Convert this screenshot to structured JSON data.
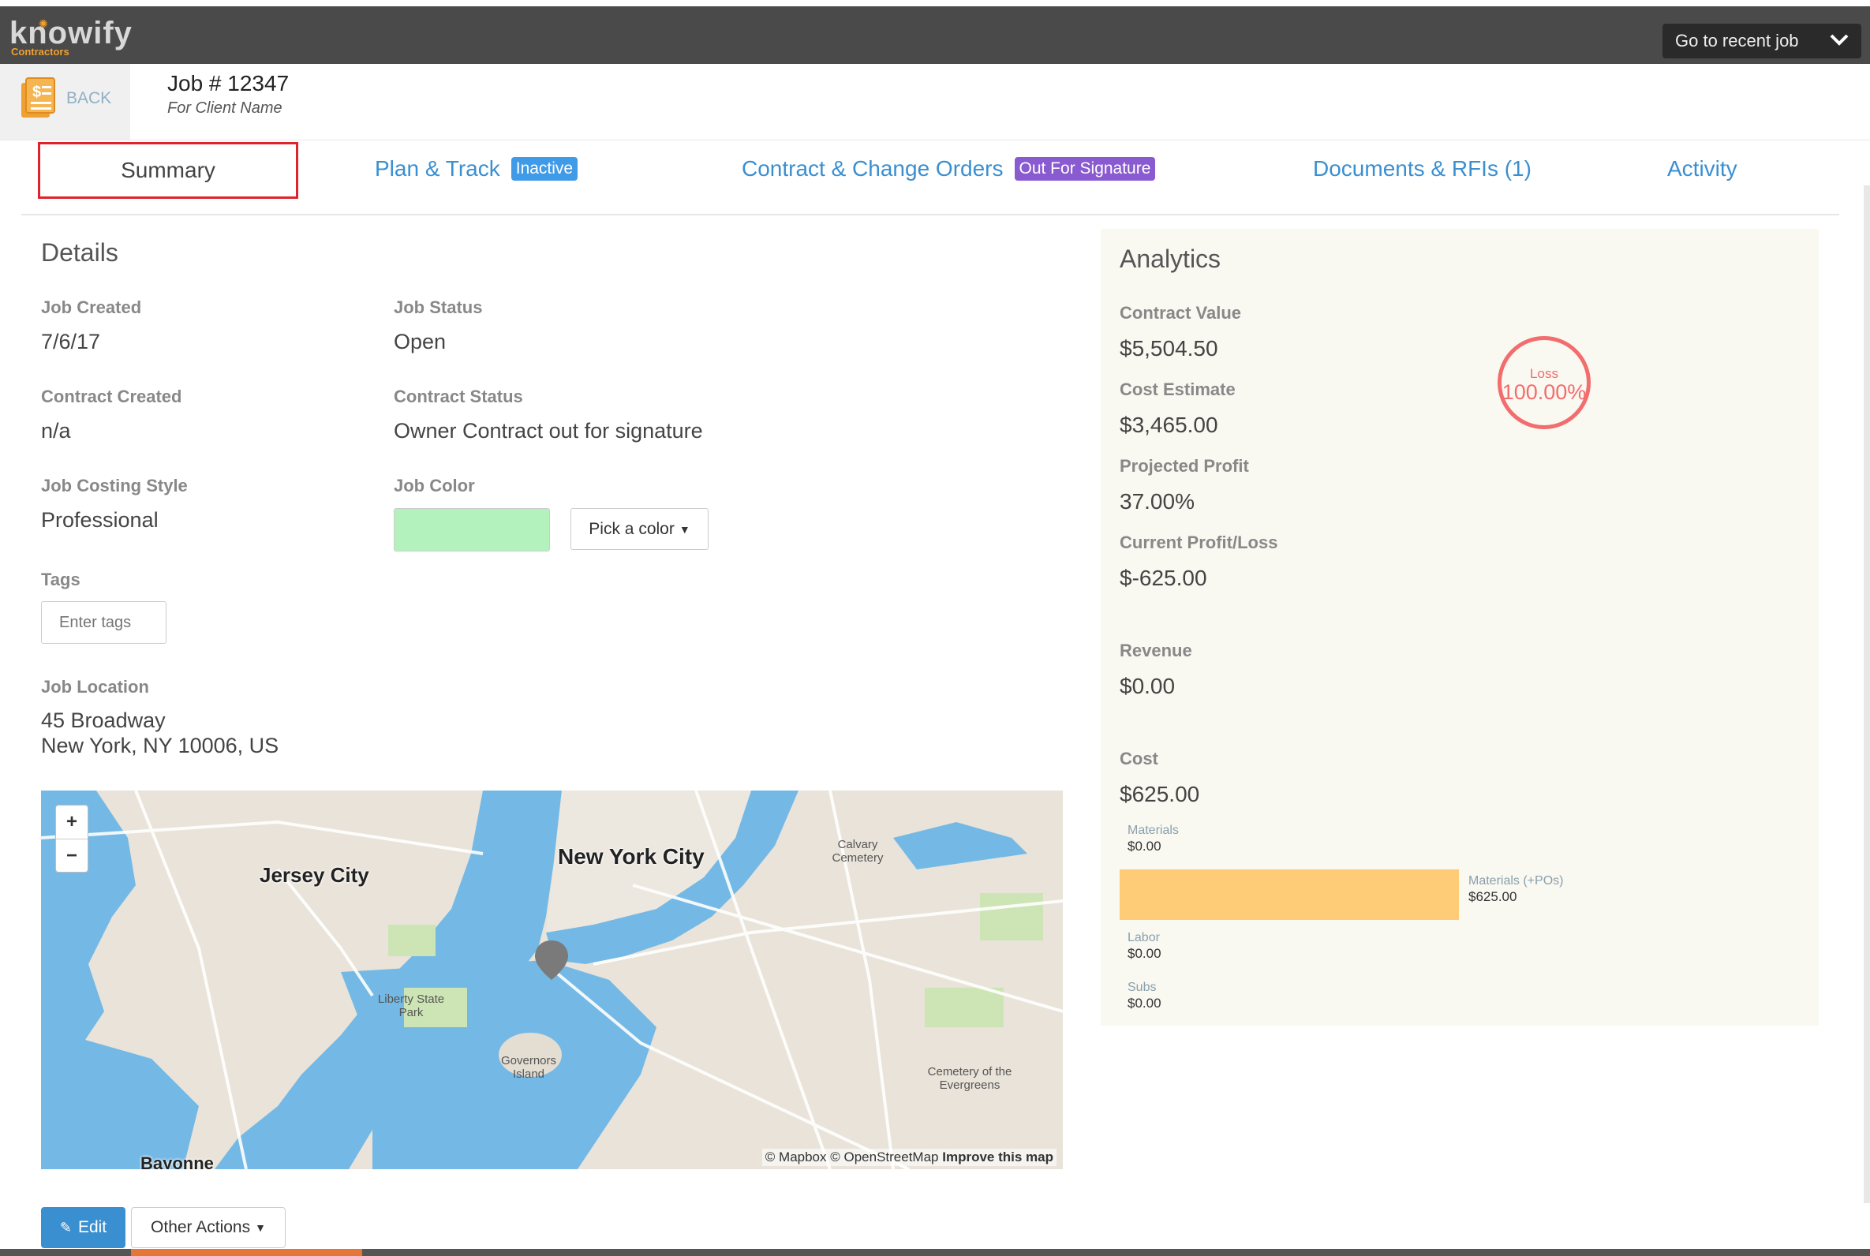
{
  "app": {
    "brand_name": "knowify",
    "brand_sub": "Contractors",
    "recent_job_label": "Go to recent job"
  },
  "job_header": {
    "back_label": "BACK",
    "job_number": "Job # 12347",
    "client_name": "For Client Name"
  },
  "tabs": [
    {
      "label": "Summary",
      "active": true
    },
    {
      "label": "Plan & Track",
      "badge": "Inactive",
      "badge_color": "#3f9ae8"
    },
    {
      "label": "Contract & Change Orders",
      "badge": "Out For Signature",
      "badge_color": "#8a5ad1"
    },
    {
      "label": "Documents & RFIs (1)"
    },
    {
      "label": "Activity"
    }
  ],
  "details": {
    "title": "Details",
    "job_created_label": "Job Created",
    "job_created_value": "7/6/17",
    "job_status_label": "Job Status",
    "job_status_value": "Open",
    "contract_created_label": "Contract Created",
    "contract_created_value": "n/a",
    "contract_status_label": "Contract Status",
    "contract_status_value": "Owner Contract out for signature",
    "costing_style_label": "Job Costing Style",
    "costing_style_value": "Professional",
    "job_color_label": "Job Color",
    "job_color_value": "#b3f2bd",
    "pick_color_label": "Pick a color",
    "tags_label": "Tags",
    "tags_placeholder": "Enter tags",
    "location_label": "Job Location",
    "location_line1": "45 Broadway",
    "location_line2": "New York, NY 10006, US"
  },
  "map": {
    "zoom_in": "+",
    "zoom_out": "−",
    "labels": {
      "nyc": "New York City",
      "jersey": "Jersey City",
      "bayonne": "Bayonne",
      "liberty": "Liberty State Park",
      "governors": "Governors Island",
      "calvary": "Calvary Cemetery",
      "evergreens": "Cemetery of the Evergreens"
    },
    "attribution": "© Mapbox © OpenStreetMap",
    "improve": "Improve this map"
  },
  "actions": {
    "edit_label": "Edit",
    "other_actions_label": "Other Actions"
  },
  "analytics": {
    "title": "Analytics",
    "contract_value_label": "Contract Value",
    "contract_value": "$5,504.50",
    "cost_estimate_label": "Cost Estimate",
    "cost_estimate": "$3,465.00",
    "projected_profit_label": "Projected Profit",
    "projected_profit": "37.00%",
    "current_pl_label": "Current Profit/Loss",
    "current_pl": "$-625.00",
    "revenue_label": "Revenue",
    "revenue": "$0.00",
    "cost_label": "Cost",
    "cost": "$625.00",
    "loss_label": "Loss",
    "loss_value": "100.00%",
    "breakdown": {
      "materials_label": "Materials",
      "materials_value": "$0.00",
      "materials_po_label": "Materials (+POs)",
      "materials_po_value": "$625.00",
      "labor_label": "Labor",
      "labor_value": "$0.00",
      "subs_label": "Subs",
      "subs_value": "$0.00"
    },
    "colors": {
      "loss": "#f26d6d",
      "materials_bar": "#fecb76"
    }
  }
}
